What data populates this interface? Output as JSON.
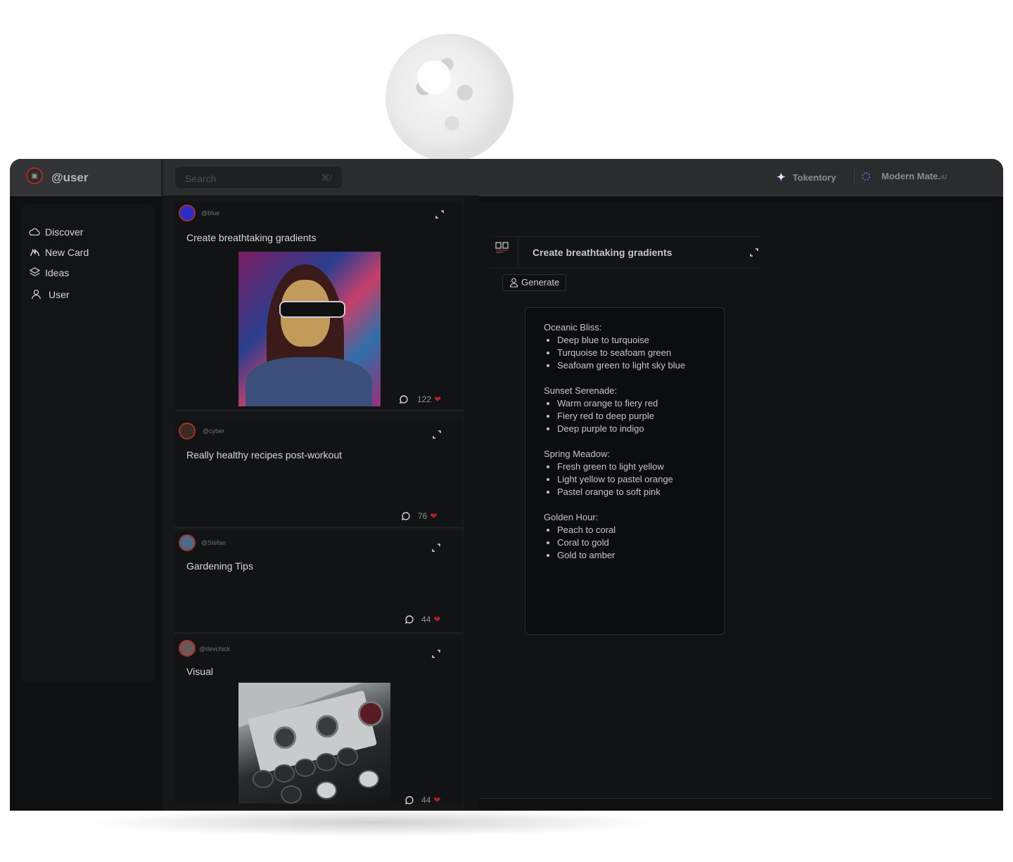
{
  "header": {
    "username": "@user",
    "search_placeholder": "Search",
    "search_shortcut": "⌘/",
    "links": [
      {
        "label": "Tokentory",
        "icon": "sparkle-icon"
      },
      {
        "label": "Modern Mate.",
        "suffix": "AI",
        "icon": "loading-ring-icon"
      }
    ]
  },
  "sidebar": {
    "items": [
      {
        "label": "Discover",
        "icon": "cloud-icon"
      },
      {
        "label": "New Card",
        "icon": "flame-icon"
      },
      {
        "label": "Ideas",
        "icon": "layers-icon"
      },
      {
        "label": "User",
        "icon": "user-icon"
      }
    ]
  },
  "feed": {
    "cards": [
      {
        "handle": "@blue",
        "title": "Create breathtaking gradients",
        "likes": "122",
        "has_image": true,
        "image": "cyberpunk-mona-lisa-portrait"
      },
      {
        "handle": "@cyber",
        "title": "Really healthy recipes post-workout",
        "likes": "76",
        "has_image": false
      },
      {
        "handle": "@Stefan",
        "title": "Gardening Tips",
        "likes": "44",
        "has_image": false
      },
      {
        "handle": "@devchick",
        "title": "Visual",
        "likes": "44",
        "has_image": true,
        "image": "synthesizer-device-photo"
      }
    ]
  },
  "detail": {
    "title": "Create breathtaking gradients",
    "generate_label": "Generate",
    "groups": [
      {
        "name": "Oceanic Bliss:",
        "items": [
          "Deep blue to turquoise",
          "Turquoise to seafoam green",
          "Seafoam green to light sky blue"
        ]
      },
      {
        "name": "Sunset Serenade:",
        "items": [
          "Warm orange to fiery red",
          "Fiery red to deep purple",
          "Deep purple to indigo"
        ]
      },
      {
        "name": "Spring Meadow:",
        "items": [
          "Fresh green to light yellow",
          "Light yellow to pastel orange",
          "Pastel orange to soft pink"
        ]
      },
      {
        "name": "Golden Hour:",
        "items": [
          "Peach to coral",
          "Coral to gold",
          "Gold to amber"
        ]
      }
    ]
  },
  "colors": {
    "app_background": "#0f1011",
    "topbar": "#2b2c2e",
    "accent_red": "#b2202a",
    "avatar_ring": "#a1322f",
    "ring_blue": "#4a6fd0"
  }
}
